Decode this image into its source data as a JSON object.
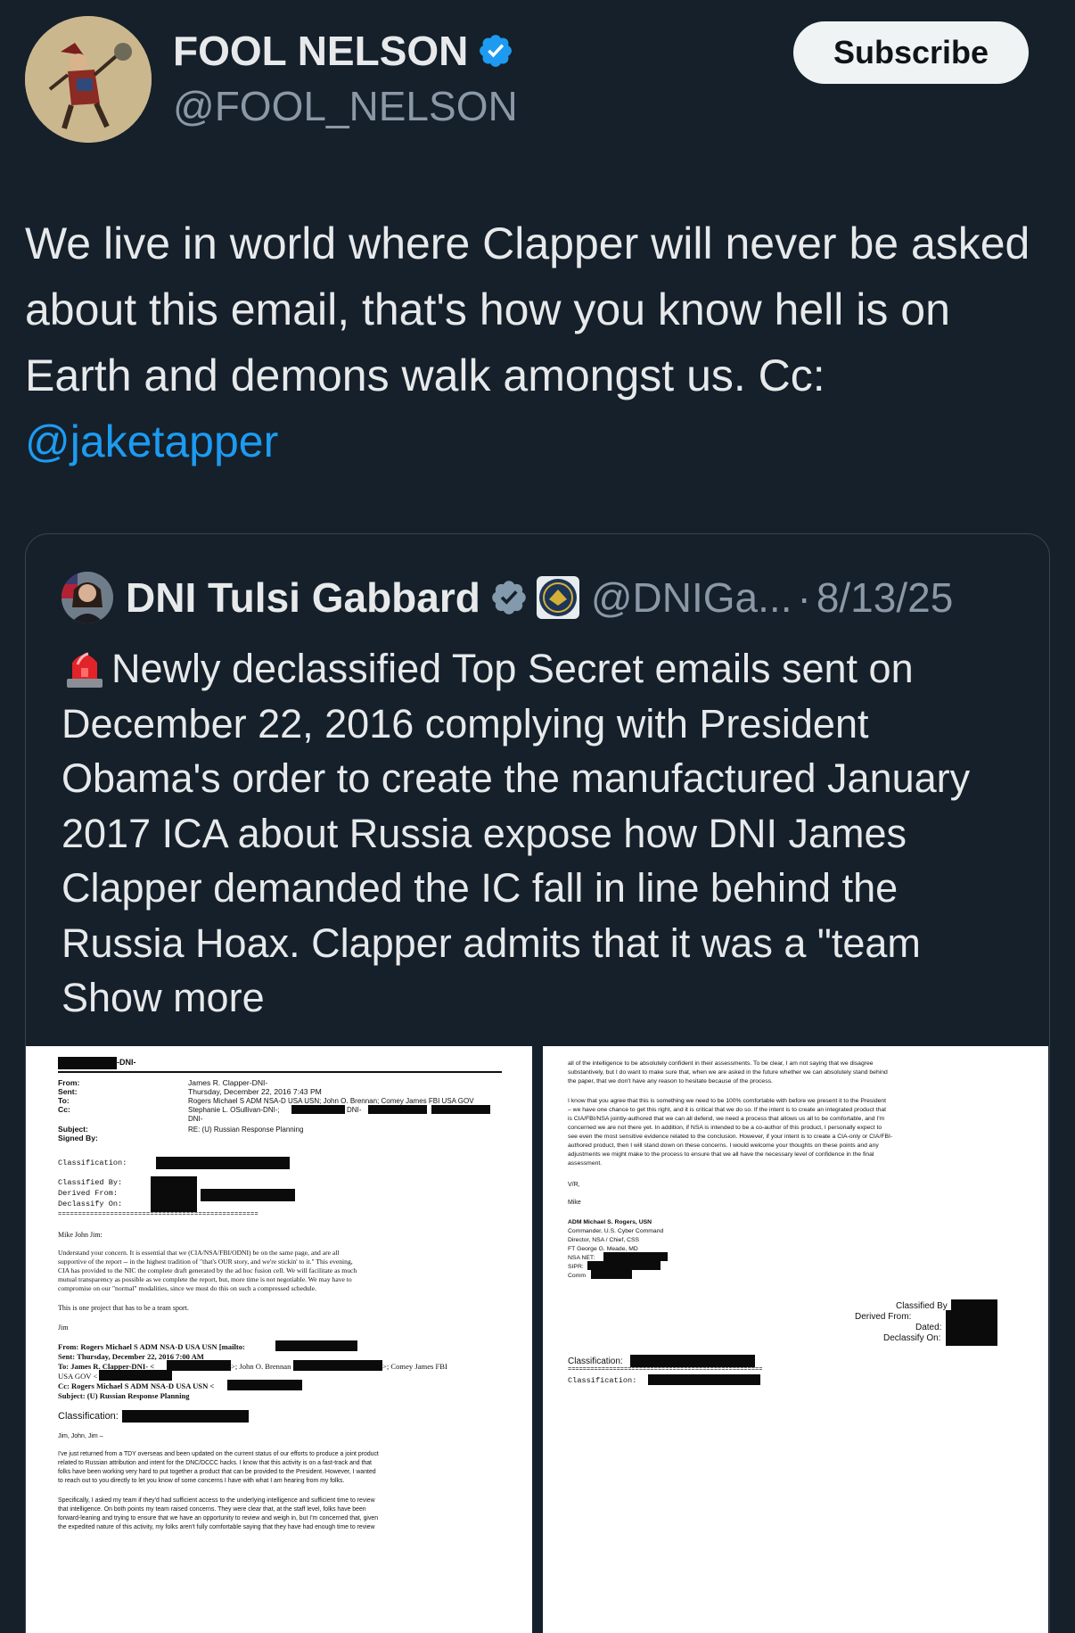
{
  "post": {
    "author": {
      "display_name": "FOOL NELSON",
      "handle": "@FOOL_NELSON",
      "verified": true,
      "avatar_icon": "jester-figure-icon"
    },
    "subscribe_label": "Subscribe",
    "text_main": "We live in world where Clapper will never be asked about this email, that's how you know hell is on Earth and demons walk amongst us. Cc: ",
    "text_mention": "@jaketapper"
  },
  "quote": {
    "author": {
      "display_name": "DNI Tulsi Gabbard",
      "handle": "@DNIGa...",
      "separator": "·",
      "date": "8/13/25",
      "verified": true,
      "verified_color": "#829aab"
    },
    "alert_icon": "rotating-light-icon",
    "text": "Newly declassified Top Secret emails sent on December 22, 2016 complying with President Obama's order to create the manufactured January 2017 ICA about Russia expose how DNI James Clapper demanded the IC fall in line behind the Russia Hoax. Clapper admits that it was a \"team",
    "show_more": "Show more"
  },
  "doc_left": {
    "header": "-DNI-",
    "labels": {
      "from": "From:",
      "sent": "Sent:",
      "to": "To:",
      "cc": "Cc:",
      "subject": "Subject:",
      "signed": "Signed By:"
    },
    "values": {
      "from": "James R. Clapper-DNI-",
      "sent": "Thursday, December 22, 2016 7:43 PM",
      "to": "Rogers Michael S ADM NSA-D USA USN; John O. Brennan; Comey James FBI USA GOV",
      "cc": "Stephanie L. OSullivan-DNI-;",
      "cc_dni": "DNI-",
      "cc2": "DNI-",
      "subject": "RE: (U) Russian Response Planning"
    },
    "classification": "Classification:",
    "classified_by": "Classified By:",
    "derived_from": "Derived From:",
    "declassify_on": "Declassify On:",
    "divider": "==================================================",
    "salutation": "Mike John Jim:",
    "para1": [
      "Understand your concern.  It is essential that we (CIA/NSA/FBI/ODNI) be on the same page, and are all",
      "supportive of the report -- in the highest tradition of \"that's OUR story, and we're stickin' to it.\"  This evening,",
      "CIA has provided to the NIC the complete draft generated by the ad hoc fusion cell.   We will facilitate as much",
      "mutual transparency as possible as we complete the report, but, more time is not negotiable.  We may have to",
      "compromise on our \"normal\" modalities, since we must do this on such a compressed schedule."
    ],
    "para2": "This is one project that has to be a team sport.",
    "sign": "Jim",
    "fwd_from": "From: Rogers Michael S ADM NSA-D USA USN [mailto:",
    "fwd_sent": "Sent: Thursday, December 22, 2016 7:00 AM",
    "fwd_to": "To: James R. Clapper-DNI- <",
    "fwd_to_mid": ">; John O. Brennan <",
    "fwd_to_end": ">; Comey James FBI",
    "fwd_to_cont": "USA GOV <",
    "fwd_cc": "Cc: Rogers Michael S ADM NSA-D USA USN <",
    "fwd_subject": "Subject: (U) Russian Response Planning",
    "classification2": "Classification:",
    "greeting": "Jim, John, Jim –",
    "para3": [
      "I've just returned from a TDY overseas and been updated on the current status of our efforts to produce a joint product",
      "related to Russian attribution and intent for the DNC/DCCC hacks. I know that this activity is on a fast-track and that",
      "folks have been working very hard to put together a product that can be provided to the President. However, I wanted",
      "to reach out to you directly to let you know of some concerns I have with what I am hearing from my folks."
    ],
    "para4": [
      "Specifically, I asked my team if they'd had sufficient access to the underlying intelligence and sufficient time to review",
      "that intelligence. On both points my team raised concerns. They were clear that, at the staff level, folks have been",
      "forward-leaning and trying to ensure that we have an opportunity to review and weigh in, but I'm concerned that, given",
      "the expedited nature of this activity, my folks aren't fully comfortable saying that they have had enough time to review"
    ]
  },
  "doc_right": {
    "para1": [
      "all of the intelligence to be absolutely confident in their assessments. To be clear, I am not saying that we disagree",
      "substantively, but I do want to make sure that, when we are asked in the future whether we can absolutely stand behind",
      "the paper, that we don't have any reason to hesitate because of the process."
    ],
    "para2": [
      "I know that you agree that this is something we need to be 100% comfortable with before we present it to the President",
      "– we have one chance to get this right, and it is critical that we do so. If the intent is to create an integrated product that",
      "is CIA/FBI/NSA jointly-authored that we can all defend, we need a process that allows us all to be comfortable, and I'm",
      "concerned we are not there yet. In addition, if NSA is intended to be a co-author of this product, I personally expect to",
      "see even the most sensitive evidence related to the conclusion. However, if your intent is to create a CIA-only or CIA/FBI-",
      "authored product, then I will stand down on these concerns. I would welcome your thoughts on these points and any",
      "adjustments we might make to the process to ensure that we all have the necessary level of confidence in the final",
      "assessment."
    ],
    "vr": "V/R,",
    "mike": "Mike",
    "sig": [
      "ADM Michael S. Rogers, USN",
      "Commander, U.S. Cyber Command",
      "Director, NSA / Chief, CSS",
      "FT George G. Meade, MD",
      "NSA NET:",
      "SIPR:",
      "Comm"
    ],
    "classified_by": "Classified By",
    "derived_from": "Derived From:",
    "dated": "Dated:",
    "declassify_on": "Declassify On:",
    "classification": "Classification:",
    "divider": "====================================================",
    "classification2": "Classification:"
  }
}
